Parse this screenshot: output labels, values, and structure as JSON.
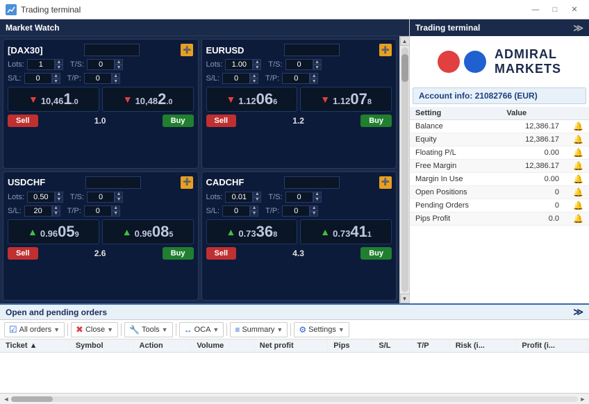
{
  "titlebar": {
    "title": "Trading terminal",
    "icon": "chart-icon"
  },
  "market_watch": {
    "header": "Market Watch",
    "cards": [
      {
        "id": "dax30",
        "symbol": "[DAX30]",
        "input_value": "",
        "lots_label": "Lots:",
        "lots_value": "1",
        "ts_label": "T/S:",
        "ts_value": "0",
        "sl_label": "S/L:",
        "sl_value": "0",
        "tp_label": "T/P:",
        "tp_value": "0",
        "sell_price_prefix": "10,46",
        "sell_price_big": "1",
        "sell_price_suffix": ".0",
        "sell_arrow": "▼",
        "sell_arrow_class": "arrow-down",
        "buy_price_prefix": "10,48",
        "buy_price_big": "2",
        "buy_price_suffix": ".0",
        "buy_arrow": "▼",
        "buy_arrow_class": "arrow-down",
        "spread": "1.0",
        "sell_label": "Sell",
        "buy_label": "Buy"
      },
      {
        "id": "eurusd",
        "symbol": "EURUSD",
        "input_value": "",
        "lots_label": "Lots:",
        "lots_value": "1.00",
        "ts_label": "T/S:",
        "ts_value": "0",
        "sl_label": "S/L:",
        "sl_value": "0",
        "tp_label": "T/P:",
        "tp_value": "0",
        "sell_price_prefix": "1.12",
        "sell_price_big": "06",
        "sell_price_suffix": "6",
        "sell_arrow": "▼",
        "sell_arrow_class": "arrow-down",
        "buy_price_prefix": "1.12",
        "buy_price_big": "07",
        "buy_price_suffix": "8",
        "buy_arrow": "▼",
        "buy_arrow_class": "arrow-down",
        "spread": "1.2",
        "sell_label": "Sell",
        "buy_label": "Buy"
      },
      {
        "id": "usdchf",
        "symbol": "USDCHF",
        "input_value": "",
        "lots_label": "Lots:",
        "lots_value": "0.50",
        "ts_label": "T/S:",
        "ts_value": "0",
        "sl_label": "S/L:",
        "sl_value": "20",
        "tp_label": "T/P:",
        "tp_value": "0",
        "sell_price_prefix": "0.96",
        "sell_price_big": "05",
        "sell_price_suffix": "9",
        "sell_arrow": "▲",
        "sell_arrow_class": "arrow-up",
        "buy_price_prefix": "0.96",
        "buy_price_big": "08",
        "buy_price_suffix": "5",
        "buy_arrow": "▲",
        "buy_arrow_class": "arrow-up",
        "spread": "2.6",
        "sell_label": "Sell",
        "buy_label": "Buy"
      },
      {
        "id": "cadchf",
        "symbol": "CADCHF",
        "input_value": "",
        "lots_label": "Lots:",
        "lots_value": "0.01",
        "ts_label": "T/S:",
        "ts_value": "0",
        "sl_label": "S/L:",
        "sl_value": "0",
        "tp_label": "T/P:",
        "tp_value": "0",
        "sell_price_prefix": "0.73",
        "sell_price_big": "36",
        "sell_price_suffix": "8",
        "sell_arrow": "▲",
        "sell_arrow_class": "arrow-up",
        "buy_price_prefix": "0.73",
        "buy_price_big": "41",
        "buy_price_suffix": "1",
        "buy_arrow": "▲",
        "buy_arrow_class": "arrow-up",
        "spread": "4.3",
        "sell_label": "Sell",
        "buy_label": "Buy"
      }
    ]
  },
  "right_panel": {
    "header": "Trading terminal",
    "account_info": "Account info: 21082766 (EUR)",
    "logo_top": "ADMIRAL",
    "logo_bottom": "MARKETS",
    "table_headers": [
      "Setting",
      "Value"
    ],
    "rows": [
      {
        "setting": "Balance",
        "value": "12,386.17"
      },
      {
        "setting": "Equity",
        "value": "12,386.17"
      },
      {
        "setting": "Floating P/L",
        "value": "0.00"
      },
      {
        "setting": "Free Margin",
        "value": "12,386.17"
      },
      {
        "setting": "Margin In Use",
        "value": "0.00"
      },
      {
        "setting": "Open Positions",
        "value": "0"
      },
      {
        "setting": "Pending Orders",
        "value": "0"
      },
      {
        "setting": "Pips Profit",
        "value": "0.0"
      }
    ]
  },
  "bottom_panel": {
    "header": "Open and pending orders",
    "toolbar": {
      "all_orders": "All orders",
      "close": "Close",
      "tools": "Tools",
      "oca": "OCA",
      "summary": "Summary",
      "settings": "Settings"
    },
    "table_headers": [
      "Ticket ▲",
      "Symbol",
      "Action",
      "Volume",
      "Net profit",
      "Pips",
      "S/L",
      "T/P",
      "Risk (i...",
      "Profit (i..."
    ]
  }
}
